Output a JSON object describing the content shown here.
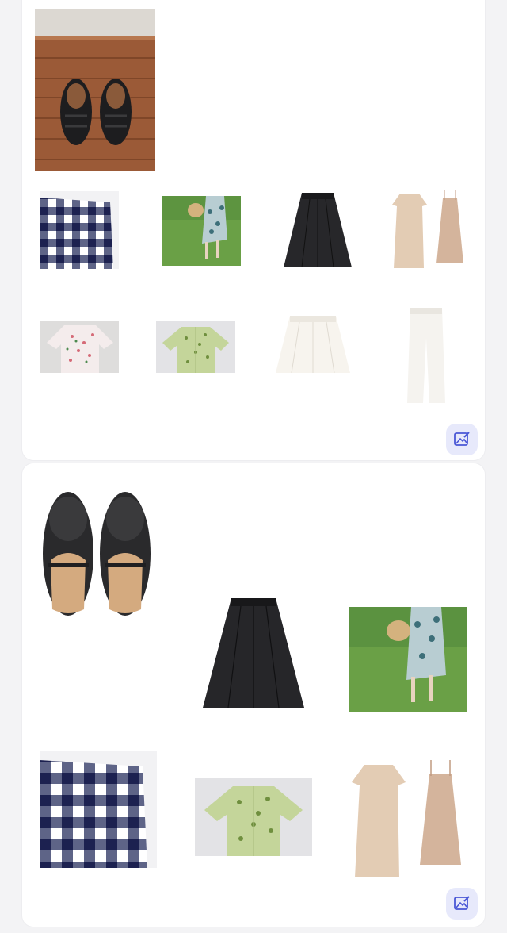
{
  "collages": [
    {
      "items": [
        {
          "name": "black-leather-sandals"
        },
        {
          "name": "gingham-check-pants"
        },
        {
          "name": "floral-dress-straw-hat-photo"
        },
        {
          "name": "black-pleated-skirt"
        },
        {
          "name": "beige-dress-and-slip-set"
        },
        {
          "name": "pink-floral-blouse"
        },
        {
          "name": "green-floral-shirt"
        },
        {
          "name": "white-skirt"
        },
        {
          "name": "white-wide-pants"
        }
      ],
      "action": {
        "icon": "edit-image-icon"
      }
    },
    {
      "items": [
        {
          "name": "black-mary-jane-shoes"
        },
        {
          "name": "black-pleated-skirt"
        },
        {
          "name": "floral-dress-straw-hat-photo"
        },
        {
          "name": "gingham-check-pants"
        },
        {
          "name": "green-floral-shirt"
        },
        {
          "name": "beige-dress-and-slip-set"
        }
      ],
      "action": {
        "icon": "edit-image-icon"
      }
    }
  ],
  "colors": {
    "accent": "#4a57d6",
    "accent_bg": "#e7e9fb",
    "card_bg": "#ffffff",
    "page_bg": "#f3f3f5"
  }
}
